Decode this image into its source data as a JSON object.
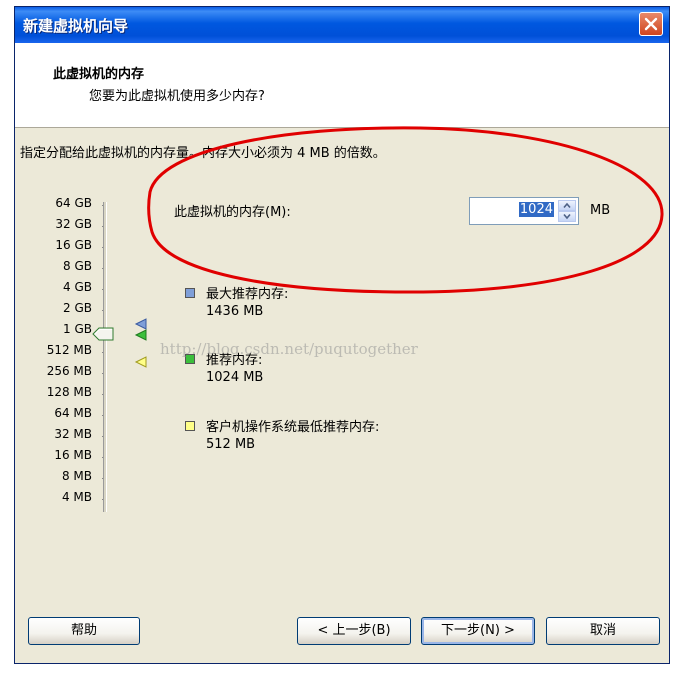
{
  "window": {
    "title": "新建虚拟机向导",
    "close_label": "关闭"
  },
  "header": {
    "title": "此虚拟机的内存",
    "subtitle": "您要为此虚拟机使用多少内存?"
  },
  "instruction": "指定分配给此虚拟机的内存量。内存大小必须为 4 MB 的倍数。",
  "memory": {
    "label": "此虚拟机的内存(M):",
    "value": "1024",
    "unit": "MB"
  },
  "scale": {
    "labels": [
      "64 GB",
      "32 GB",
      "16 GB",
      "8 GB",
      "4 GB",
      "2 GB",
      "1 GB",
      "512 MB",
      "256 MB",
      "128 MB",
      "64 MB",
      "32 MB",
      "16 MB",
      "8 MB",
      "4 MB"
    ],
    "selected": "1 GB"
  },
  "legend": [
    {
      "label": "最大推荐内存:",
      "value": "1436 MB",
      "color": "#7f9fd8"
    },
    {
      "label": "推荐内存:",
      "value": "1024 MB",
      "color": "#3cbf3c"
    },
    {
      "label": "客户机操作系统最低推荐内存:",
      "value": "512 MB",
      "color": "#ffff88"
    }
  ],
  "watermark": "http://blog.csdn.net/puqutogether",
  "buttons": {
    "help": "帮助",
    "back": "< 上一步(B)",
    "next": "下一步(N) >",
    "cancel": "取消"
  },
  "colors": {
    "annotation": "#e00000",
    "title_bar": "#0058e0",
    "dialog_bg": "#ece9d8"
  }
}
